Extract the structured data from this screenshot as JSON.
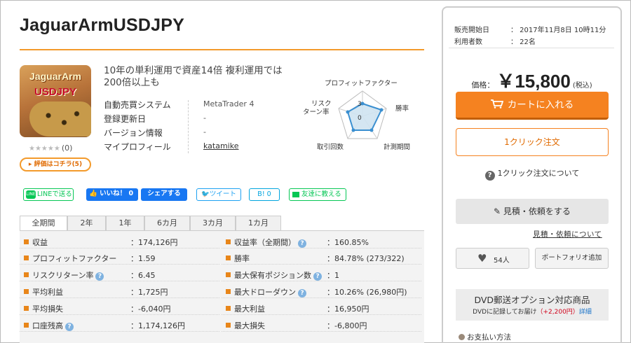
{
  "product": {
    "title": "JaguarArmUSDJPY",
    "thumbnail_text_1": "JaguarArm",
    "thumbnail_text_2": "USDJPY",
    "stars": "★★★★★",
    "review_count": "(0)",
    "reviews_button": "▸ 評価はコチラ(5)",
    "description": "10年の単利運用で資産14倍 複利運用では200倍以上も"
  },
  "info": [
    {
      "label": "自動売買システム",
      "value": "MetaTrader 4"
    },
    {
      "label": "登録更新日",
      "value": "-"
    },
    {
      "label": "バージョン情報",
      "value": "-"
    },
    {
      "label": "マイプロフィール",
      "value": "katamike"
    }
  ],
  "radar": {
    "labels": {
      "top": "プロフィットファクター",
      "right_top": "勝率",
      "right_bottom": "計測期間",
      "bottom": "取引回数",
      "left_top_1": "リスク",
      "left_top_2": "ターン率"
    },
    "ticks": [
      "3",
      "0"
    ],
    "fill_color": "#cfe3f1",
    "stroke_color": "#3a8fd0"
  },
  "social": {
    "line": "LINEで送る",
    "line_icon": "LINE",
    "fb_like": "いいね！ 0",
    "fb_share": "シェアする",
    "tweet": "ツイート",
    "hatena": "B! 0",
    "friend": "友達に教える"
  },
  "tabs": [
    "全期間",
    "2年",
    "1年",
    "6カ月",
    "3カ月",
    "1カ月"
  ],
  "stats_left": [
    {
      "label": "収益",
      "value": "174,126円",
      "help": false
    },
    {
      "label": "プロフィットファクター",
      "value": "1.59",
      "help": false
    },
    {
      "label": "リスクリターン率",
      "value": "6.45",
      "help": true
    },
    {
      "label": "平均利益",
      "value": "1,725円",
      "help": false
    },
    {
      "label": "平均損失",
      "value": "-6,040円",
      "help": false
    },
    {
      "label": "口座残高",
      "value": "1,174,126円",
      "help": true
    }
  ],
  "stats_right": [
    {
      "label": "収益率（全期間）",
      "value": "160.85%",
      "help": true
    },
    {
      "label": "勝率",
      "value": "84.78% (273/322)",
      "help": false
    },
    {
      "label": "最大保有ポジション数",
      "value": "1",
      "help": true
    },
    {
      "label": "最大ドローダウン",
      "value": "10.26% (26,980円)",
      "help": true
    },
    {
      "label": "最大利益",
      "value": "16,950円",
      "help": false
    },
    {
      "label": "最大損失",
      "value": "-6,800円",
      "help": false
    }
  ],
  "sidebar": {
    "sale_start_label": "販売開始日",
    "sale_start_value": "：  2017年11月8日 10時11分",
    "users_label": "利用者数",
    "users_value": "：  22名",
    "price_label": "価格：",
    "price_value": "￥15,800",
    "price_tax": "(税込)",
    "cart_button": "カートに入れる",
    "oneclick_button": "1クリック注文",
    "oneclick_about": "1クリック注文について",
    "estimate_button": "見積・依頼をする",
    "estimate_link": "見積・依頼について",
    "favorite_count": "54人",
    "portfolio_button": "ポートフォリオ追加",
    "dvd_title": "DVD郵送オプション対応商品",
    "dvd_text": "DVDに記録してお届け",
    "dvd_price": "（+2,200円）",
    "dvd_detail": "詳細",
    "payment": "お支払い方法"
  },
  "colors": {
    "accent_orange": "#f58220",
    "title_rule": "#f39a2b",
    "line_green": "#06c755",
    "facebook_blue": "#1877f2",
    "twitter_blue": "#1da1f2"
  }
}
